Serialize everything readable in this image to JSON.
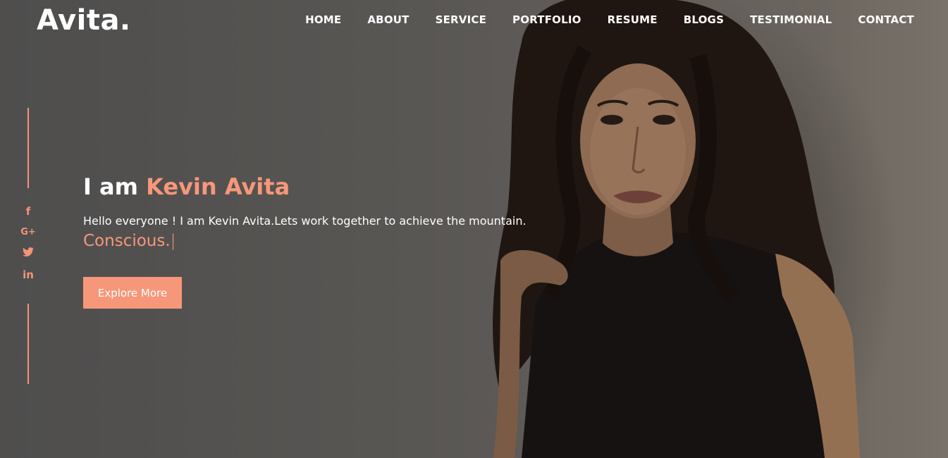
{
  "brand": {
    "logo": "Avita."
  },
  "nav": {
    "items": [
      "HOME",
      "ABOUT",
      "SERVICE",
      "PORTFOLIO",
      "RESUME",
      "BLOGS",
      "TESTIMONIAL",
      "CONTACT"
    ]
  },
  "social": {
    "icons": [
      "facebook-icon",
      "google-plus-icon",
      "twitter-icon",
      "linkedin-icon"
    ],
    "glyphs": [
      "f",
      "G+",
      "🐦",
      "in"
    ]
  },
  "hero": {
    "headline_prefix": "I am ",
    "headline_name": "Kevin Avita",
    "description": "Hello everyone ! I am Kevin Avita.Lets work together to achieve the mountain.",
    "typed_word": "Conscious.",
    "cursor": "|",
    "button_label": "Explore More"
  },
  "colors": {
    "accent": "#f7977a",
    "text": "#ffffff"
  }
}
